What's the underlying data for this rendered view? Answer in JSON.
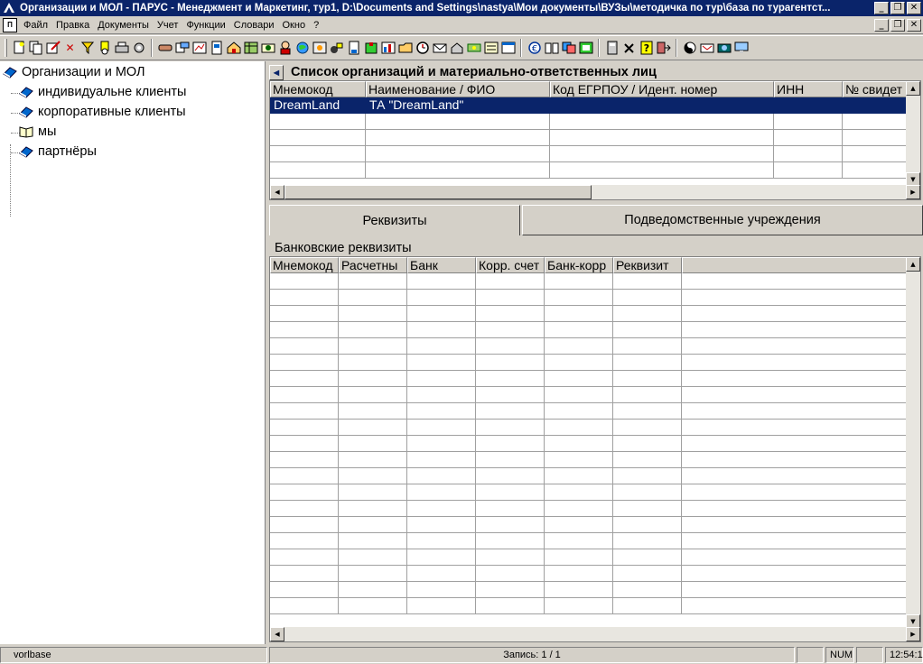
{
  "window": {
    "title": "Организации и МОЛ - ПАРУС - Менеджмент и Маркетинг, тур1, D:\\Documents and Settings\\nastya\\Мои документы\\ВУЗы\\методичка по тур\\база по турагентст...",
    "minimize": "_",
    "restore": "❐",
    "close": "✕"
  },
  "menu": {
    "items": [
      "Файл",
      "Правка",
      "Документы",
      "Учет",
      "Функции",
      "Словари",
      "Окно",
      "?"
    ]
  },
  "toolbar": {
    "group1": [
      "new-icon",
      "copy-icon",
      "edit-icon",
      "delete-icon",
      "filter-icon",
      "find-icon",
      "print-icon",
      "settings-icon"
    ],
    "group2": [
      "handshake-icon",
      "transfer-icon",
      "report-icon",
      "document-icon",
      "home-icon",
      "table-icon",
      "stamp-icon",
      "person-icon",
      "globe-icon",
      "map-icon",
      "tools-icon",
      "calc-icon",
      "building-icon",
      "chart-icon",
      "folder-icon",
      "clock-icon",
      "mail-icon",
      "house-icon",
      "money-icon",
      "list-icon",
      "grid-icon"
    ],
    "group3": [
      "euro-icon",
      "book-icon",
      "cards-icon",
      "plan-icon"
    ],
    "group4": [
      "calculator-icon",
      "hammer-icon",
      "help-icon",
      "exit-icon"
    ],
    "group5": [
      "yinyang-icon",
      "flag-icon",
      "camera-icon",
      "monitor-icon"
    ]
  },
  "tree": {
    "root": "Организации и МОЛ",
    "items": [
      "индивидуальне клиенты",
      "корпоративные клиенты",
      "мы",
      "партнёры"
    ]
  },
  "top_grid": {
    "title": "Список организаций и материально-ответственных лиц",
    "columns": [
      "Мнемокод",
      "Наименование / ФИО",
      "Код ЕГРПОУ / Идент. номер",
      "ИНН",
      "№ свидет"
    ],
    "rows": [
      [
        "DreamLand",
        "ТА \"DreamLand\"",
        "",
        "",
        ""
      ]
    ]
  },
  "tabs": {
    "requisites": "Реквизиты",
    "subordinate": "Подведомственные учреждения"
  },
  "bank_section": {
    "title": "Банковские реквизиты",
    "columns": [
      "Мнемокод",
      "Расчетны",
      "Банк",
      "Корр. счет",
      "Банк-корр",
      "Реквизит"
    ]
  },
  "status": {
    "user": "vorlbase",
    "record": "Запись: 1 / 1",
    "num": "NUM",
    "time": "12:54:12"
  }
}
